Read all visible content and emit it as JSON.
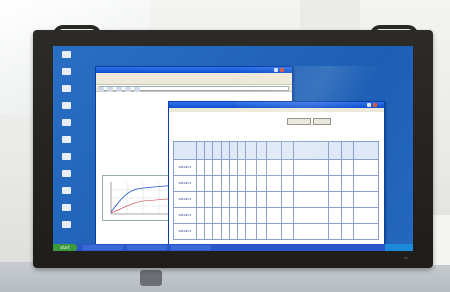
{
  "photo": {
    "subject": "wall-mounted flat panel display showing a Windows XP desktop"
  },
  "desktop": {
    "icons": [
      "",
      "",
      "",
      "",
      "",
      "",
      "",
      "",
      "",
      "",
      ""
    ],
    "taskbar": {
      "start_label": "start",
      "clock": ""
    }
  },
  "back_window": {
    "title": "",
    "menu": "",
    "heading_text": "",
    "subheading": "",
    "label_1": "",
    "label_2": "",
    "label_3": ""
  },
  "front_window": {
    "title": "",
    "menu": "",
    "header_line_1": "",
    "header_line_2": "",
    "button_1": "",
    "button_2": "",
    "table_caption": "",
    "table": {
      "rows": [
        {
          "date": "2004/5/11"
        },
        {
          "date": "2004/5/11"
        },
        {
          "date": "2004/5/11"
        },
        {
          "date": "2004/5/11"
        },
        {
          "date": "2004/5/11"
        }
      ]
    }
  },
  "colors": {
    "desktop_blue": "#1d5fb5",
    "xp_titlebar": "#0f4fcf",
    "bezel": "#1f1d1b"
  }
}
